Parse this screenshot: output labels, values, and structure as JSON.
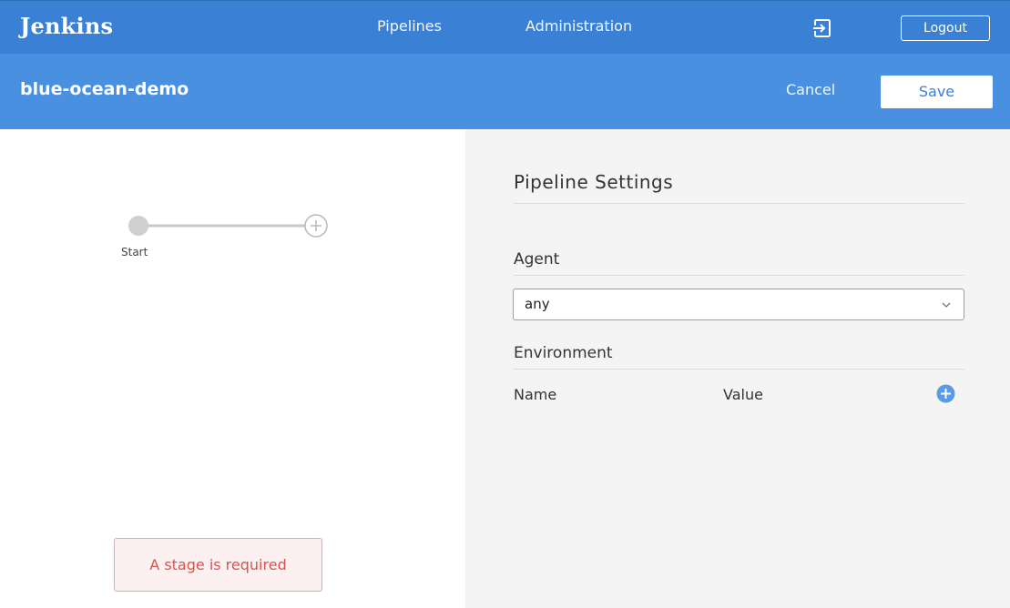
{
  "header": {
    "brand": "Jenkins",
    "nav": {
      "pipelines": "Pipelines",
      "administration": "Administration"
    },
    "logout_label": "Logout"
  },
  "editor_header": {
    "pipeline_name": "blue-ocean-demo",
    "cancel_label": "Cancel",
    "save_label": "Save"
  },
  "graph": {
    "start_label": "Start",
    "error_message": "A stage is required"
  },
  "settings": {
    "title": "Pipeline Settings",
    "agent": {
      "label": "Agent",
      "selected": "any"
    },
    "environment": {
      "label": "Environment",
      "columns": {
        "name": "Name",
        "value": "Value"
      }
    }
  },
  "colors": {
    "nav_bg": "#3a80d4",
    "subheader_bg": "#4a90e0",
    "panel_bg": "#f4f4f4",
    "error_text": "#d9534f"
  }
}
